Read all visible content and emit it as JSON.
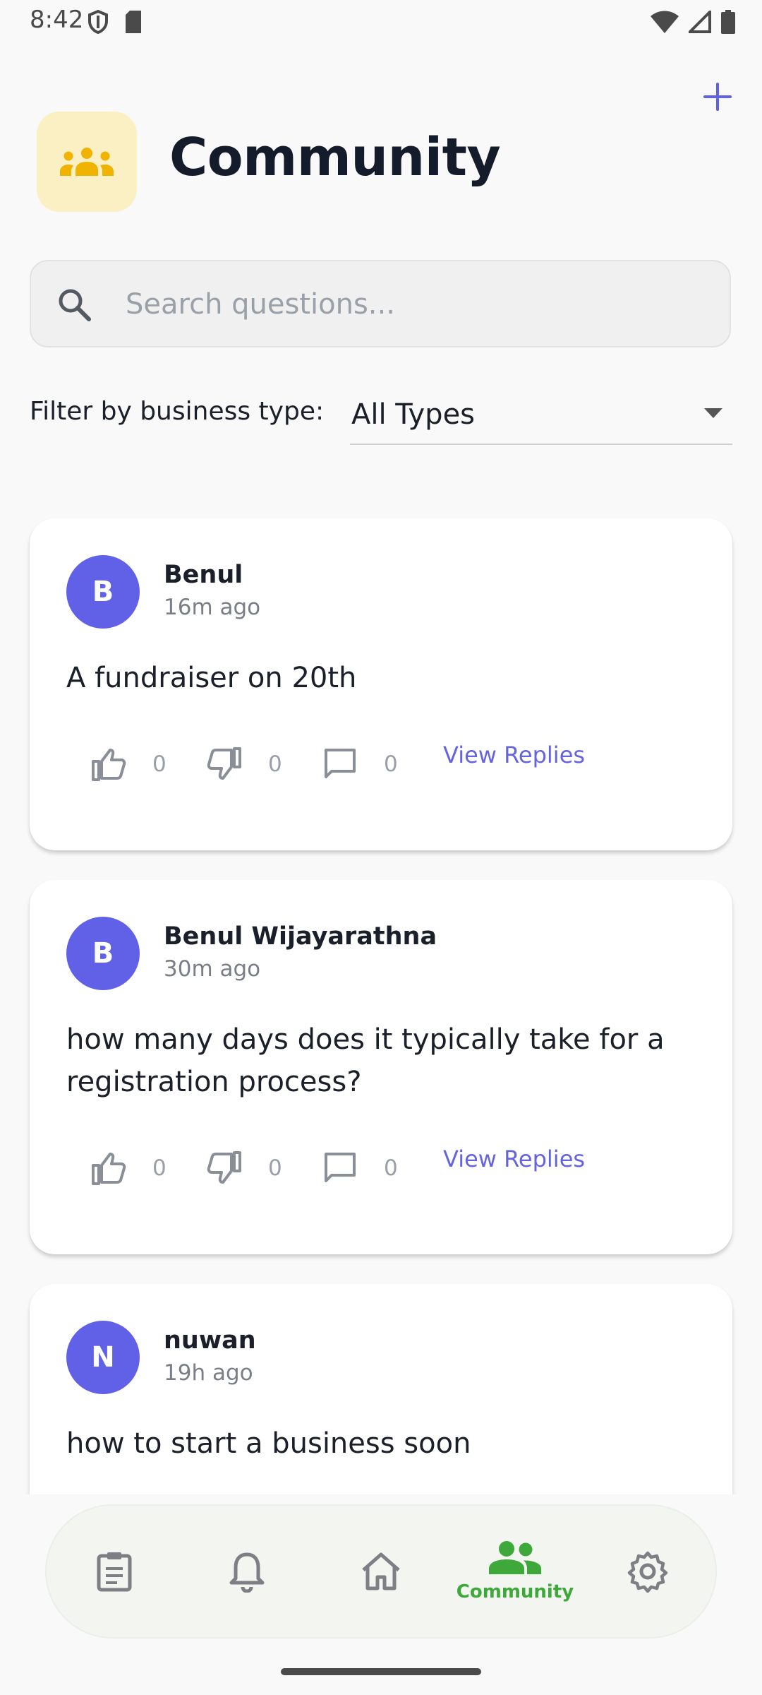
{
  "status": {
    "time": "8:42"
  },
  "header": {
    "title": "Community"
  },
  "search": {
    "placeholder": "Search questions...",
    "value": ""
  },
  "filter": {
    "label": "Filter by business type:",
    "selected": "All Types"
  },
  "posts": [
    {
      "avatar_letter": "B",
      "author": "Benul",
      "time": "16m ago",
      "text": "A fundraiser on 20th",
      "likes": "0",
      "dislikes": "0",
      "comments": "0",
      "view_replies": "View Replies"
    },
    {
      "avatar_letter": "B",
      "author": "Benul Wijayarathna",
      "time": "30m ago",
      "text": "how many days does it typically take for a registration process?",
      "likes": "0",
      "dislikes": "0",
      "comments": "0",
      "view_replies": "View Replies"
    },
    {
      "avatar_letter": "N",
      "author": "nuwan",
      "time": "19h ago",
      "text": "how to start a business soon"
    }
  ],
  "nav": {
    "items": [
      {
        "icon": "clipboard-icon"
      },
      {
        "icon": "bell-icon"
      },
      {
        "icon": "home-icon"
      },
      {
        "icon": "community-icon",
        "label": "Community",
        "active": true
      },
      {
        "icon": "gear-icon"
      }
    ]
  },
  "colors": {
    "accent": "#6161e8",
    "active_nav": "#3ea83a",
    "header_icon_bg": "#fbefc4",
    "header_icon": "#f0b400"
  }
}
